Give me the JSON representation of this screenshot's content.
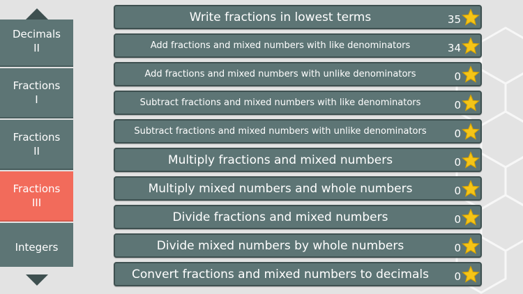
{
  "sidebar": {
    "items": [
      {
        "line1": "Decimals",
        "line2": "II",
        "active": false
      },
      {
        "line1": "Fractions",
        "line2": "I",
        "active": false
      },
      {
        "line1": "Fractions",
        "line2": "II",
        "active": false
      },
      {
        "line1": "Fractions",
        "line2": "III",
        "active": true
      },
      {
        "line1": "Integers",
        "line2": "",
        "active": false
      }
    ],
    "up_icon": "triangle-up-icon",
    "down_icon": "triangle-down-icon"
  },
  "lessons": [
    {
      "title": "Write fractions in lowest terms",
      "stars": "35"
    },
    {
      "title": "Add fractions and mixed numbers with like denominators",
      "stars": "34"
    },
    {
      "title": "Add fractions and mixed numbers with unlike denominators",
      "stars": "0"
    },
    {
      "title": "Subtract fractions and mixed numbers with like denominators",
      "stars": "0"
    },
    {
      "title": "Subtract fractions and mixed numbers with unlike denominators",
      "stars": "0"
    },
    {
      "title": "Multiply fractions and mixed numbers",
      "stars": "0"
    },
    {
      "title": "Multiply mixed numbers and whole numbers",
      "stars": "0"
    },
    {
      "title": "Divide fractions and mixed numbers",
      "stars": "0"
    },
    {
      "title": "Divide mixed numbers by whole numbers",
      "stars": "0"
    },
    {
      "title": "Convert fractions and mixed numbers to decimals",
      "stars": "0"
    }
  ],
  "colors": {
    "panel": "#5d7575",
    "active": "#f26b5b",
    "star": "#f5c518",
    "background": "#e3e3e3"
  }
}
